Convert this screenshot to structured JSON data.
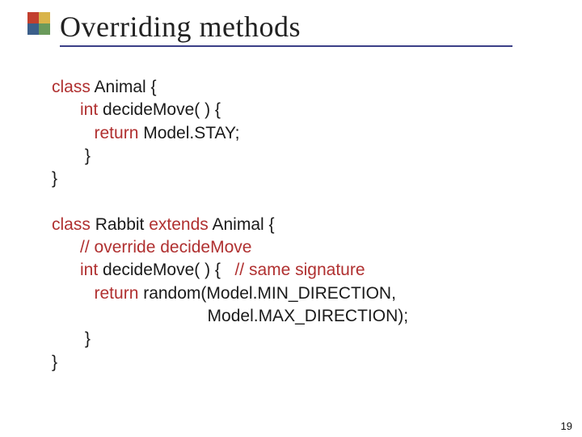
{
  "slide": {
    "title": "Overriding methods",
    "page_number": "19"
  },
  "code1": {
    "l1a": "class ",
    "l1b": "Animal {",
    "l2a": "      int ",
    "l2b": "decideMove( ) {",
    "l3a": "         return ",
    "l3b": "Model.STAY;",
    "l4": "       }",
    "l5": "}"
  },
  "code2": {
    "l1a": "class ",
    "l1b": "Rabbit ",
    "l1c": "extends ",
    "l1d": "Animal {",
    "l2": "      // override decideMove",
    "l3a": "      int ",
    "l3b": "decideMove( ) {   ",
    "l3c": "// same signature",
    "l4a": "         return ",
    "l4b": "random(Model.MIN_DIRECTION,",
    "l5": "                                 Model.MAX_DIRECTION);",
    "l6": "       }",
    "l7": "}"
  }
}
